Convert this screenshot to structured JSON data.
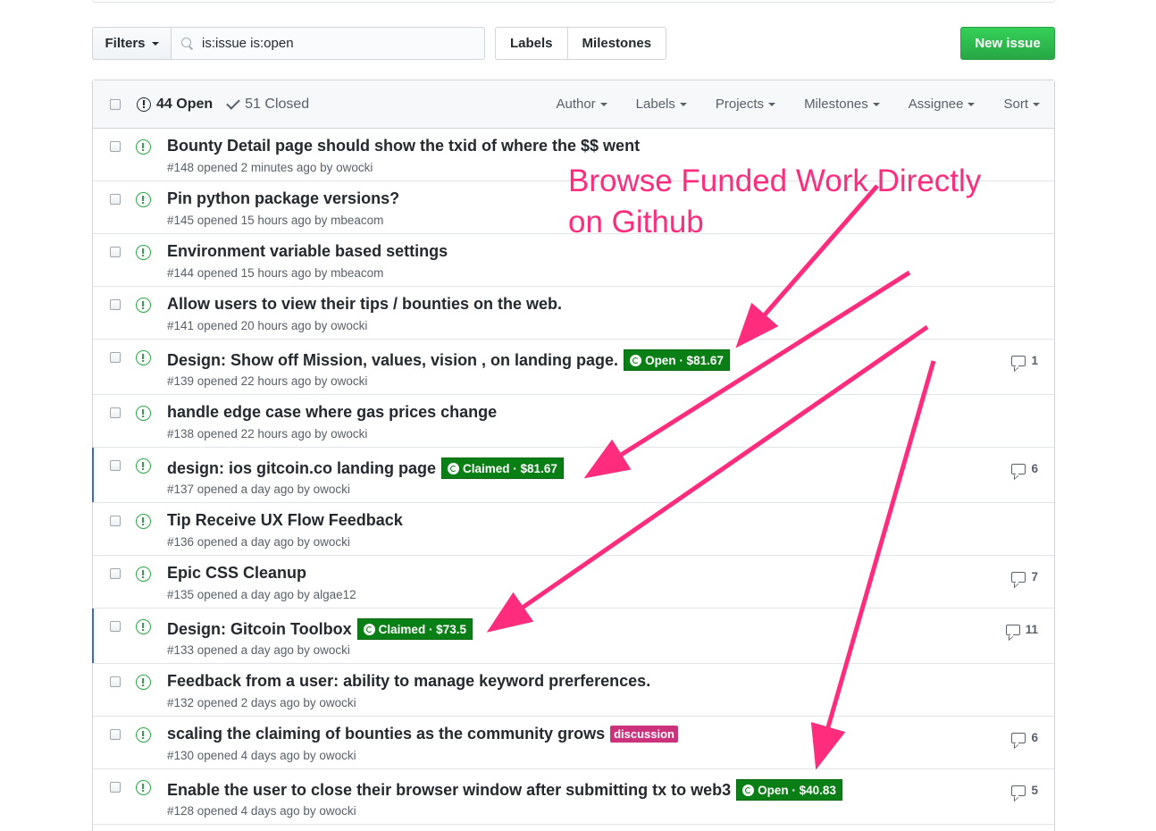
{
  "toolbar": {
    "filters_label": "Filters",
    "search_value": "is:issue is:open",
    "labels_label": "Labels",
    "milestones_label": "Milestones",
    "new_issue_label": "New issue"
  },
  "header": {
    "open_count": "44 Open",
    "closed_count": "51 Closed",
    "filters": [
      "Author",
      "Labels",
      "Projects",
      "Milestones",
      "Assignee",
      "Sort"
    ]
  },
  "issues": [
    {
      "title": "Bounty Detail page should show the txid of where the $$ went",
      "meta": "#148 opened 2 minutes ago by owocki"
    },
    {
      "title": "Pin python package versions?",
      "meta": "#145 opened 15 hours ago by mbeacom"
    },
    {
      "title": "Environment variable based settings",
      "meta": "#144 opened 15 hours ago by mbeacom"
    },
    {
      "title": "Allow users to view their tips / bounties on the web.",
      "meta": "#141 opened 20 hours ago by owocki"
    },
    {
      "title": "Design: Show off Mission, values, vision , on landing page.",
      "meta": "#139 opened 22 hours ago by owocki",
      "badge": "Open · $81.67",
      "comments": "1"
    },
    {
      "title": "handle edge case where gas prices change",
      "meta": "#138 opened 22 hours ago by owocki"
    },
    {
      "title": "design: ios gitcoin.co landing page",
      "meta": "#137 opened a day ago by owocki",
      "badge": "Claimed · $81.67",
      "comments": "6"
    },
    {
      "title": "Tip Receive UX Flow Feedback",
      "meta": "#136 opened a day ago by owocki"
    },
    {
      "title": "Epic CSS Cleanup",
      "meta": "#135 opened a day ago by algae12",
      "comments": "7"
    },
    {
      "title": "Design: Gitcoin Toolbox",
      "meta": "#133 opened a day ago by owocki",
      "badge": "Claimed · $73.5",
      "comments": "11"
    },
    {
      "title": "Feedback from a user: ability to manage keyword prerferences.",
      "meta": "#132 opened 2 days ago by owocki"
    },
    {
      "title": "scaling the claiming of bounties as the community grows",
      "meta": "#130 opened 4 days ago by owocki",
      "label": "discussion",
      "comments": "6"
    },
    {
      "title": "Enable the user to close their browser window after submitting tx to web3",
      "meta": "#128 opened 4 days ago by owocki",
      "badge": "Open · $40.83",
      "comments": "5"
    }
  ],
  "annotation": {
    "line1": "Browse Funded Work Directly",
    "line2": "on Github",
    "color": "#ff2c7d"
  },
  "colors": {
    "open_green": "#28a745",
    "bounty_green": "#0a7f15",
    "discussion_pink": "#cc317c",
    "active_blue": "#2f6bdd"
  }
}
